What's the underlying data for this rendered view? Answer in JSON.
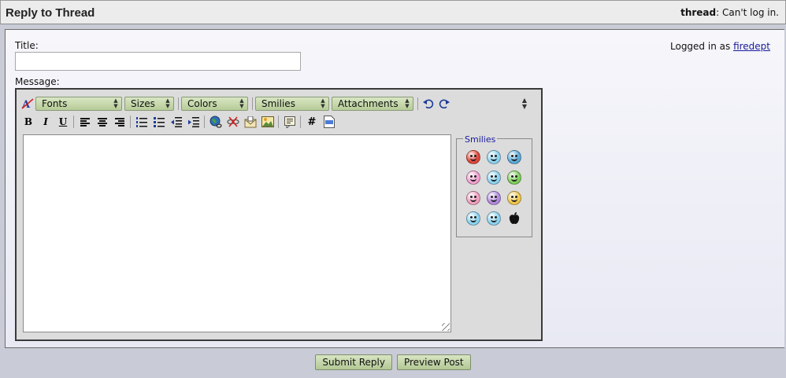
{
  "header": {
    "title": "Reply to Thread",
    "thread_label": "thread",
    "thread_value": ": Can't log in."
  },
  "form": {
    "title_label": "Title:",
    "title_value": "",
    "message_label": "Message:",
    "logged_in_text": "Logged in as",
    "username": "firedept"
  },
  "toolbar": {
    "dropdowns": [
      "Fonts",
      "Sizes",
      "Colors",
      "Smilies",
      "Attachments"
    ],
    "format_buttons": {
      "bold": "B",
      "italic": "I",
      "underline": "U"
    },
    "code_label": "#"
  },
  "smilies": {
    "legend": "Smilies",
    "colors": [
      "#e0463a",
      "#8cd3f0",
      "#5aaad8",
      "#f2a0d0",
      "#8cd3f0",
      "#7fce5c",
      "#f2a0c0",
      "#b48ae0",
      "#f0c84a",
      "#8cd3f0",
      "#8cd3f0",
      "#111111"
    ]
  },
  "buttons": {
    "submit": "Submit Reply",
    "preview": "Preview Post"
  },
  "colors": {
    "button_green": "#c4d8a8",
    "link": "#1a1a9a",
    "smilies_legend": "#1a1a9a"
  }
}
